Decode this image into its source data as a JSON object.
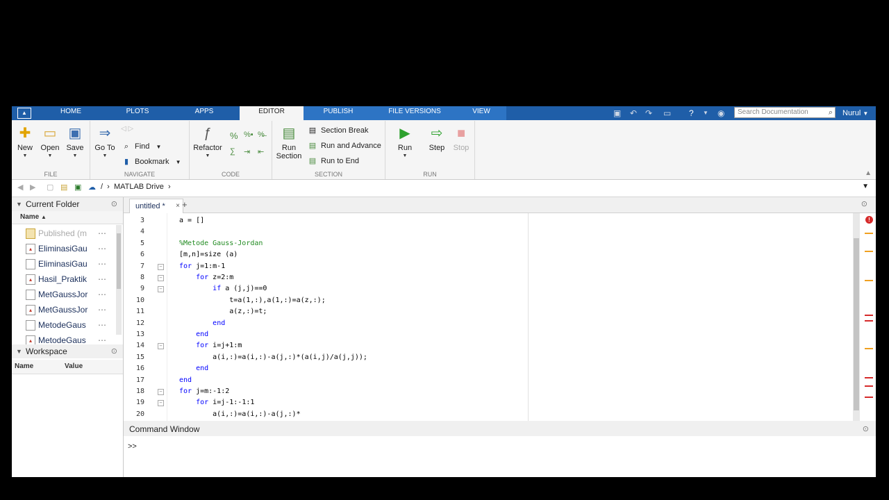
{
  "tabs": [
    "HOME",
    "PLOTS",
    "APPS",
    "EDITOR",
    "PUBLISH",
    "FILE VERSIONS",
    "VIEW"
  ],
  "search": {
    "placeholder": "Search Documentation"
  },
  "user": "Nurul",
  "toolstrip": {
    "file": {
      "label": "FILE",
      "new": "New",
      "open": "Open",
      "save": "Save"
    },
    "navigate": {
      "label": "NAVIGATE",
      "goto": "Go To",
      "find": "Find",
      "bookmark": "Bookmark"
    },
    "code": {
      "label": "CODE",
      "refactor": "Refactor"
    },
    "section": {
      "label": "SECTION",
      "run_section_1": "Run",
      "run_section_2": "Section",
      "section_break": "Section Break",
      "run_advance": "Run and Advance",
      "run_end": "Run to End"
    },
    "run": {
      "label": "RUN",
      "run": "Run",
      "step": "Step",
      "stop": "Stop"
    }
  },
  "address": {
    "sep": "/",
    "crumb": "MATLAB Drive"
  },
  "current_folder": {
    "title": "Current Folder",
    "col_name": "Name",
    "items": [
      "Published (m",
      "EliminasiGau",
      "EliminasiGau",
      "Hasil_Praktik",
      "MetGaussJor",
      "MetGaussJor",
      "MetodeGaus",
      "MetodeGaus"
    ]
  },
  "workspace": {
    "title": "Workspace",
    "col_name": "Name",
    "col_value": "Value"
  },
  "editor": {
    "tab": "untitled *",
    "line_numbers": [
      "3",
      "4",
      "5",
      "6",
      "7",
      "8",
      "9",
      "10",
      "11",
      "12",
      "13",
      "14",
      "15",
      "16",
      "17",
      "18",
      "19",
      "20"
    ],
    "lines": [
      "a = []",
      "",
      "%Metode Gauss-Jordan",
      "[m,n]=size (a)",
      "for j=1:m-1",
      "    for z=2:m",
      "        if a (j,j)==0",
      "            t=a(1,:),a(1,:)=a(z,:);",
      "            a(z,:)=t;",
      "        end",
      "    end",
      "    for i=j+1:m",
      "        a(i,:)=a(i,:)-a(j,:)*(a(i,j)/a(j,j));",
      "    end",
      "end",
      "for j=m:-1:2",
      "    for i=j-1:-1:1",
      "        a(i,:)=a(i,:)-a(j,:)*"
    ]
  },
  "command_window": {
    "title": "Command Window",
    "prompt": ">>"
  },
  "colors": {
    "tab_bar": "#1f5ea8",
    "comment": "#228b22",
    "keyword": "#0000ff",
    "error": "#d62a2a",
    "warning": "#f0a020"
  }
}
